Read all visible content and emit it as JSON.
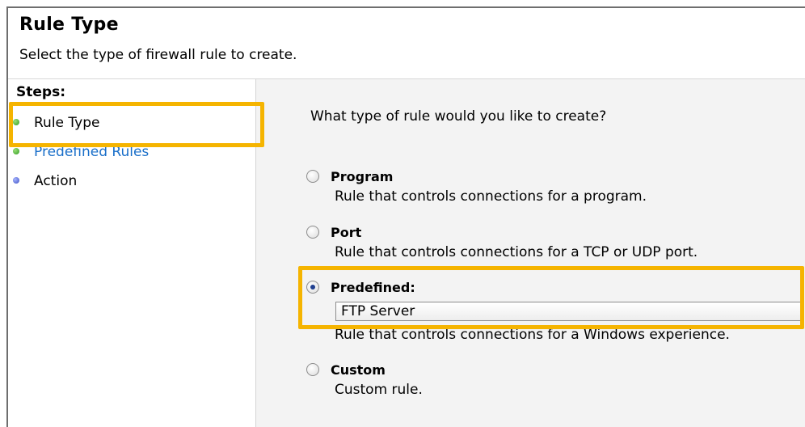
{
  "header": {
    "title": "Rule Type",
    "subtitle": "Select the type of firewall rule to create."
  },
  "steps": {
    "title": "Steps:",
    "items": [
      {
        "label": "Rule Type",
        "state": "current",
        "icon": "green-dot-icon"
      },
      {
        "label": "Predefined Rules",
        "state": "link",
        "icon": "green-dot-icon"
      },
      {
        "label": "Action",
        "state": "pending",
        "icon": "blue-dot-icon"
      }
    ]
  },
  "main": {
    "question": "What type of rule would you like to create?",
    "options": [
      {
        "label": "Program",
        "description": "Rule that controls connections for a program.",
        "checked": false
      },
      {
        "label": "Port",
        "description": "Rule that controls connections for a TCP or UDP port.",
        "checked": false
      },
      {
        "label": "Predefined:",
        "description": "Rule that controls connections for a Windows experience.",
        "checked": true
      },
      {
        "label": "Custom",
        "description": "Custom rule.",
        "checked": false
      }
    ],
    "predefined_select": {
      "value": "FTP Server"
    }
  },
  "colors": {
    "highlight": "#f5b400",
    "link": "#1a6fc9",
    "main_bg": "#f3f3f3"
  }
}
